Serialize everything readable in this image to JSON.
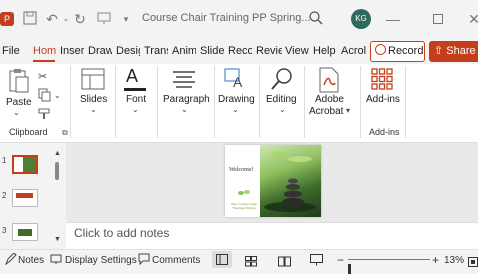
{
  "app": {
    "accent": "#c43e1c",
    "user_initials": "KG"
  },
  "titlebar": {
    "doc_title": "Course Chair Training PP Spring..."
  },
  "tabs": [
    {
      "label": "File"
    },
    {
      "label": "Hom"
    },
    {
      "label": "Inser"
    },
    {
      "label": "Draw"
    },
    {
      "label": "Desig"
    },
    {
      "label": "Trans"
    },
    {
      "label": "Anim"
    },
    {
      "label": "Slide"
    },
    {
      "label": "Reco"
    },
    {
      "label": "Revie"
    },
    {
      "label": "View"
    },
    {
      "label": "Help"
    },
    {
      "label": "Acrol"
    }
  ],
  "actions": {
    "record": "Record",
    "share": "Share"
  },
  "ribbon": {
    "paste": "Paste",
    "clipboard_group": "Clipboard",
    "slides": "Slides",
    "font": "Font",
    "paragraph": "Paragraph",
    "drawing": "Drawing",
    "editing": "Editing",
    "adobe_line1": "Adobe",
    "adobe_line2": "Acrobat",
    "addins": "Add-ins",
    "addins_group": "Add-ins"
  },
  "slide_panel": {
    "slide_numbers": [
      "1",
      "2",
      "3"
    ]
  },
  "slide": {
    "welcome": "Welcome!",
    "subtitle": "Wee Courses Clear Theology Ministry"
  },
  "notes": {
    "placeholder": "Click to add notes"
  },
  "statusbar": {
    "notes": "Notes",
    "display_settings": "Display Settings",
    "comments": "Comments",
    "zoom_percent": "13%",
    "zoom_level": 0.13
  }
}
